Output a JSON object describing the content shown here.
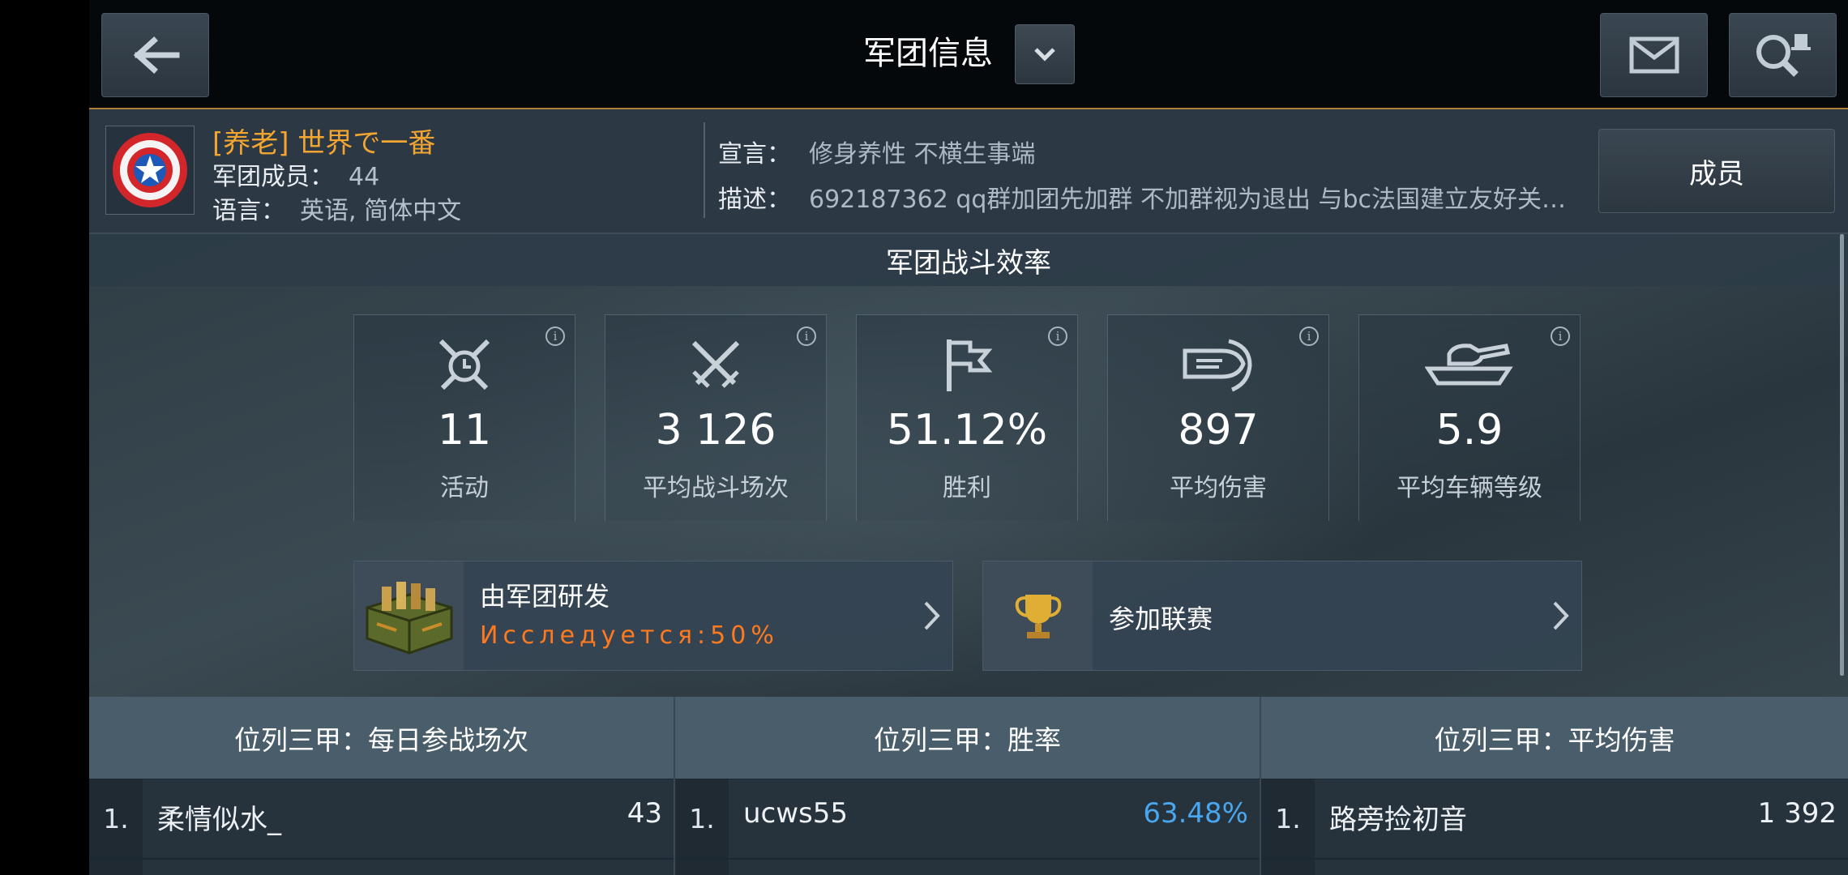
{
  "topbar": {
    "title": "军团信息"
  },
  "clan": {
    "name": "[养老] 世界で一番",
    "members_label": "军团成员：",
    "members_value": "44",
    "language_label": "语言：",
    "language_value": "英语, 简体中文",
    "motto_label": "宣言：",
    "motto_value": "修身养性 不横生事端",
    "desc_label": "描述：",
    "desc_value": "692187362 qq群加团先加群 不加群视为退出 与bc法国建立友好关…",
    "members_button": "成员"
  },
  "efficiency": {
    "title": "军团战斗效率",
    "stats": [
      {
        "icon": "activity-clock-swords-icon",
        "value": "11",
        "label": "活动"
      },
      {
        "icon": "crossed-swords-icon",
        "value": "3 126",
        "label": "平均战斗场次"
      },
      {
        "icon": "flag-icon",
        "value": "51.12%",
        "label": "胜利"
      },
      {
        "icon": "shell-damage-icon",
        "value": "897",
        "label": "平均伤害"
      },
      {
        "icon": "tank-icon",
        "value": "5.9",
        "label": "平均车辆等级"
      }
    ],
    "info_glyph": "i"
  },
  "promos": {
    "research_title": "由军团研发",
    "research_status": "Исследуется:50%",
    "league_title": "参加联赛"
  },
  "leaderboards": [
    {
      "title": "位列三甲：每日参战场次",
      "rank": "1.",
      "player": "柔情似水_",
      "value": "43"
    },
    {
      "title": "位列三甲：胜率",
      "rank": "1.",
      "player": "ucws55",
      "value": "63.48%"
    },
    {
      "title": "位列三甲：平均伤害",
      "rank": "1.",
      "player": "路旁捡初音",
      "value": "1 392"
    }
  ],
  "colors": {
    "accent_gold": "#f2a530",
    "research_orange": "#ff7a1e",
    "winrate_blue": "#4aa6ef"
  }
}
